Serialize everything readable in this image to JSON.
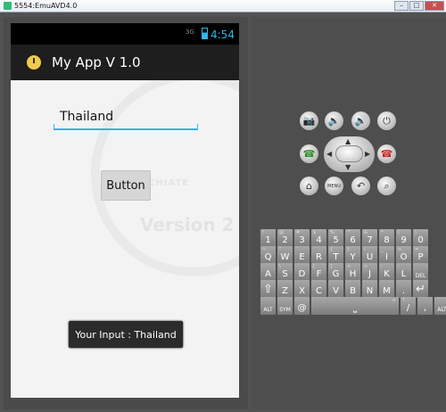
{
  "window": {
    "title": "5554:EmuAVD4.0",
    "minimize": "–",
    "maximize": "□",
    "close": "✕"
  },
  "statusbar": {
    "signal": "3G",
    "time": "4:54"
  },
  "app": {
    "title": "My App V 1.0",
    "input_value": "Thailand",
    "button_label": "Button",
    "toast": "Your Input : Thailand"
  },
  "controls": {
    "camera": "📷",
    "volume_down": "🔉",
    "volume_up": "🔊",
    "power": "⏻",
    "call": "☎",
    "end_call": "☎",
    "home": "⌂",
    "menu": "MENU",
    "back": "↶",
    "search": "⌕",
    "dpad_up": "▲",
    "dpad_down": "▼",
    "dpad_left": "◀",
    "dpad_right": "▶"
  },
  "keyboard": {
    "row1": [
      {
        "key": "1",
        "sup": "!"
      },
      {
        "key": "2",
        "sup": "@"
      },
      {
        "key": "3",
        "sup": "#"
      },
      {
        "key": "4",
        "sup": "$"
      },
      {
        "key": "5",
        "sup": "%"
      },
      {
        "key": "6",
        "sup": "^"
      },
      {
        "key": "7",
        "sup": "&"
      },
      {
        "key": "8",
        "sup": "*"
      },
      {
        "key": "9",
        "sup": "("
      },
      {
        "key": "0",
        "sup": ")"
      }
    ],
    "row2": [
      {
        "key": "Q",
        "sup": "~"
      },
      {
        "key": "W",
        "sup": "\""
      },
      {
        "key": "E",
        "sup": "´"
      },
      {
        "key": "R",
        "sup": ""
      },
      {
        "key": "T",
        "sup": "{"
      },
      {
        "key": "Y",
        "sup": "}"
      },
      {
        "key": "U",
        "sup": "-"
      },
      {
        "key": "I",
        "sup": "_"
      },
      {
        "key": "O",
        "sup": "+"
      },
      {
        "key": "P",
        "sup": "="
      }
    ],
    "row3": [
      {
        "key": "A",
        "sup": ""
      },
      {
        "key": "S",
        "sup": "\\"
      },
      {
        "key": "D",
        "sup": ""
      },
      {
        "key": "F",
        "sup": "["
      },
      {
        "key": "G",
        "sup": "]"
      },
      {
        "key": "H",
        "sup": "<"
      },
      {
        "key": "J",
        "sup": ">"
      },
      {
        "key": "K",
        "sup": ";"
      },
      {
        "key": "L",
        "sup": ":"
      },
      {
        "key": "DEL",
        "sup": ""
      }
    ],
    "row4": [
      {
        "key": "⇧",
        "sup": ""
      },
      {
        "key": "Z",
        "sup": ""
      },
      {
        "key": "X",
        "sup": ""
      },
      {
        "key": "C",
        "sup": ""
      },
      {
        "key": "V",
        "sup": ""
      },
      {
        "key": "B",
        "sup": ""
      },
      {
        "key": "N",
        "sup": ""
      },
      {
        "key": "M",
        "sup": ""
      },
      {
        "key": ".",
        "sup": ""
      },
      {
        "key": "↵",
        "sup": ""
      }
    ],
    "row5": [
      {
        "key": "ALT",
        "sup": ""
      },
      {
        "key": "SYM",
        "sup": ""
      },
      {
        "key": "@",
        "sup": ""
      },
      {
        "key": "⎵",
        "sup": "⇥"
      },
      {
        "key": "/",
        "sup": "?"
      },
      {
        "key": ",",
        "sup": ""
      },
      {
        "key": "ALT",
        "sup": ""
      }
    ]
  }
}
